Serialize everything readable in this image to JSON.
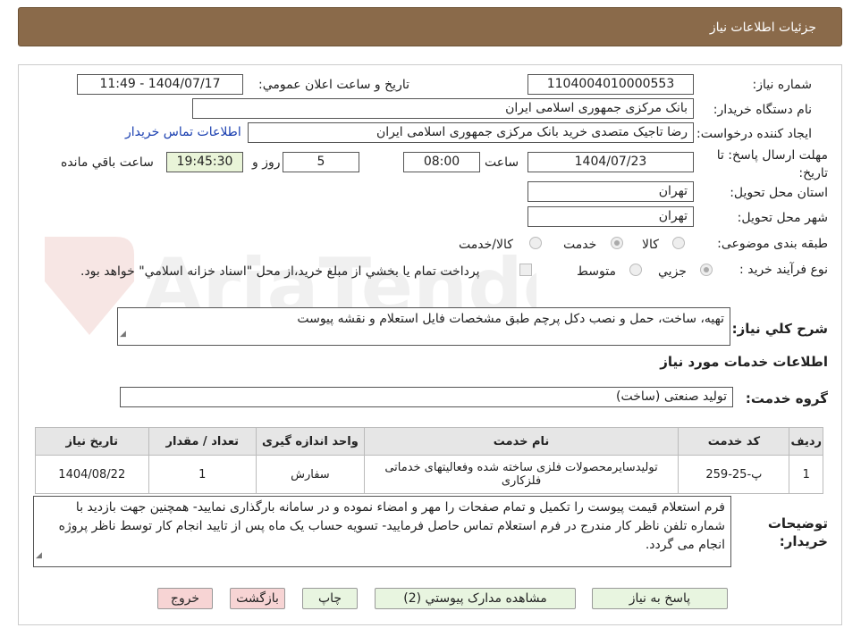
{
  "header": {
    "title": "جزئیات اطلاعات نیاز"
  },
  "fields": {
    "need_number_label": "شماره نیاز:",
    "need_number": "1104004010000553",
    "announce_label": "تاريخ و ساعت اعلان عمومي:",
    "announce_value": "1404/07/17 - 11:49",
    "buyer_org_label": "نام دستگاه خريدار:",
    "buyer_org": "بانک مرکزی جمهوری اسلامی ایران",
    "creator_label": "ايجاد کننده درخواست:",
    "creator": "رضا تاجیک متصدی خرید بانک مرکزی جمهوری اسلامی ایران",
    "contact_link": "اطلاعات تماس خريدار",
    "deadline_label": "مهلت ارسال پاسخ: تا تاريخ:",
    "deadline_date": "1404/07/23",
    "time_label": "ساعت",
    "deadline_time": "08:00",
    "days_value": "5",
    "days_label": "روز و",
    "remaining_time": "19:45:30",
    "remaining_label": "ساعت باقي مانده",
    "province_label": "استان محل تحويل:",
    "province": "تهران",
    "city_label": "شهر محل تحويل:",
    "city": "تهران",
    "category_label": "طبقه بندی موضوعی:",
    "category_options": [
      "کالا",
      "خدمت",
      "کالا/خدمت"
    ],
    "category_selected": "خدمت",
    "process_label": "نوع فرآيند خريد :",
    "process_options": [
      "جزيي",
      "متوسط"
    ],
    "process_selected": "جزيي",
    "treasury_note": "پرداخت تمام يا بخشي از مبلغ خريد،از محل \"اسناد خزانه اسلامي\" خواهد بود."
  },
  "summary": {
    "label": "شرح كلي نياز:",
    "text": "تهیه، ساخت، حمل و نصب دکل پرچم طبق مشخصات فایل استعلام و نقشه پیوست"
  },
  "services": {
    "title": "اطلاعات خدمات مورد نياز",
    "group_label": "گروه خدمت:",
    "group_value": "تولید صنعتی (ساخت)",
    "columns": [
      "رديف",
      "کد خدمت",
      "نام خدمت",
      "واحد اندازه گيری",
      "تعداد / مقدار",
      "تاريخ نياز"
    ],
    "rows": [
      [
        "1",
        "پ-25-259",
        "تولیدسایرمحصولات فلزی ساخته شده وفعالیتهای خدماتی فلزکاری",
        "سفارش",
        "1",
        "1404/08/22"
      ]
    ]
  },
  "buyer_notes": {
    "label_line1": "توضيحات",
    "label_line2": "خريدار:",
    "text": "فرم استعلام قیمت پیوست را تکمیل و تمام صفحات را مهر و امضاء نموده و در سامانه بارگذاری نمایید- همچنین جهت بازدید با شماره تلفن ناظر کار مندرج در فرم استعلام تماس حاصل فرمایید- تسویه حساب یک ماه پس از تایید انجام کار توسط ناظر پروژه انجام می گردد."
  },
  "buttons": {
    "reply": "پاسخ به نياز",
    "attachments": "مشاهده مدارک پيوستي (2)",
    "print": "چاپ",
    "back": "بازگشت",
    "exit": "خروج"
  },
  "watermark": "AriaTender.neT",
  "colors": {
    "header_bg": "#8a6a4a",
    "link": "#1a3fb0",
    "button_green": "#e8f5e0",
    "button_red": "#f7d4d4"
  }
}
